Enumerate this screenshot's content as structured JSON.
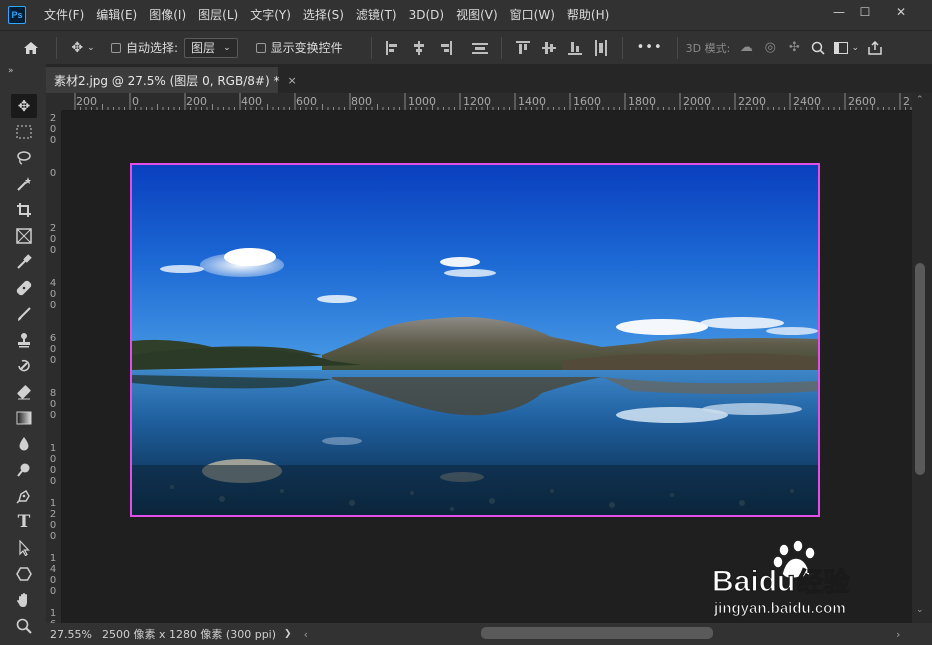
{
  "app": {
    "logo": "Ps"
  },
  "menu": [
    "文件(F)",
    "编辑(E)",
    "图像(I)",
    "图层(L)",
    "文字(Y)",
    "选择(S)",
    "滤镜(T)",
    "3D(D)",
    "视图(V)",
    "窗口(W)",
    "帮助(H)"
  ],
  "window_controls": {
    "minimize": "—",
    "maximize": "☐",
    "close": "✕"
  },
  "options": {
    "home_icon": "home-icon",
    "move_icon": "move-icon",
    "auto_select_label": "自动选择:",
    "auto_select_target": "图层",
    "show_transform_label": "显示变换控件",
    "more_label": "•••",
    "mode_3d_label": "3D 模式:"
  },
  "tab": {
    "title": "素材2.jpg @ 27.5% (图层 0, RGB/8#) *",
    "close": "×"
  },
  "ruler": {
    "top_ticks": [
      "200",
      "0",
      "200",
      "400",
      "600",
      "800",
      "1000",
      "1200",
      "1400",
      "1600",
      "1800",
      "2000",
      "2200",
      "2400",
      "2600",
      "2"
    ],
    "left_ticks": [
      "200",
      "0",
      "200",
      "400",
      "600",
      "800",
      "1000",
      "1200",
      "1400",
      "16"
    ]
  },
  "status": {
    "zoom": "27.55%",
    "doc_info": "2500 像素 x 1280 像素 (300 ppi)",
    "arrow": "❯"
  },
  "watermark": {
    "brand": "Bai",
    "brand_du": "du",
    "brand_suffix": "经验",
    "url": "jingyan.baidu.com"
  },
  "colors": {
    "selection_border": "#e24ee8",
    "panel": "#323232",
    "canvas_bg": "#1f1f1f"
  }
}
